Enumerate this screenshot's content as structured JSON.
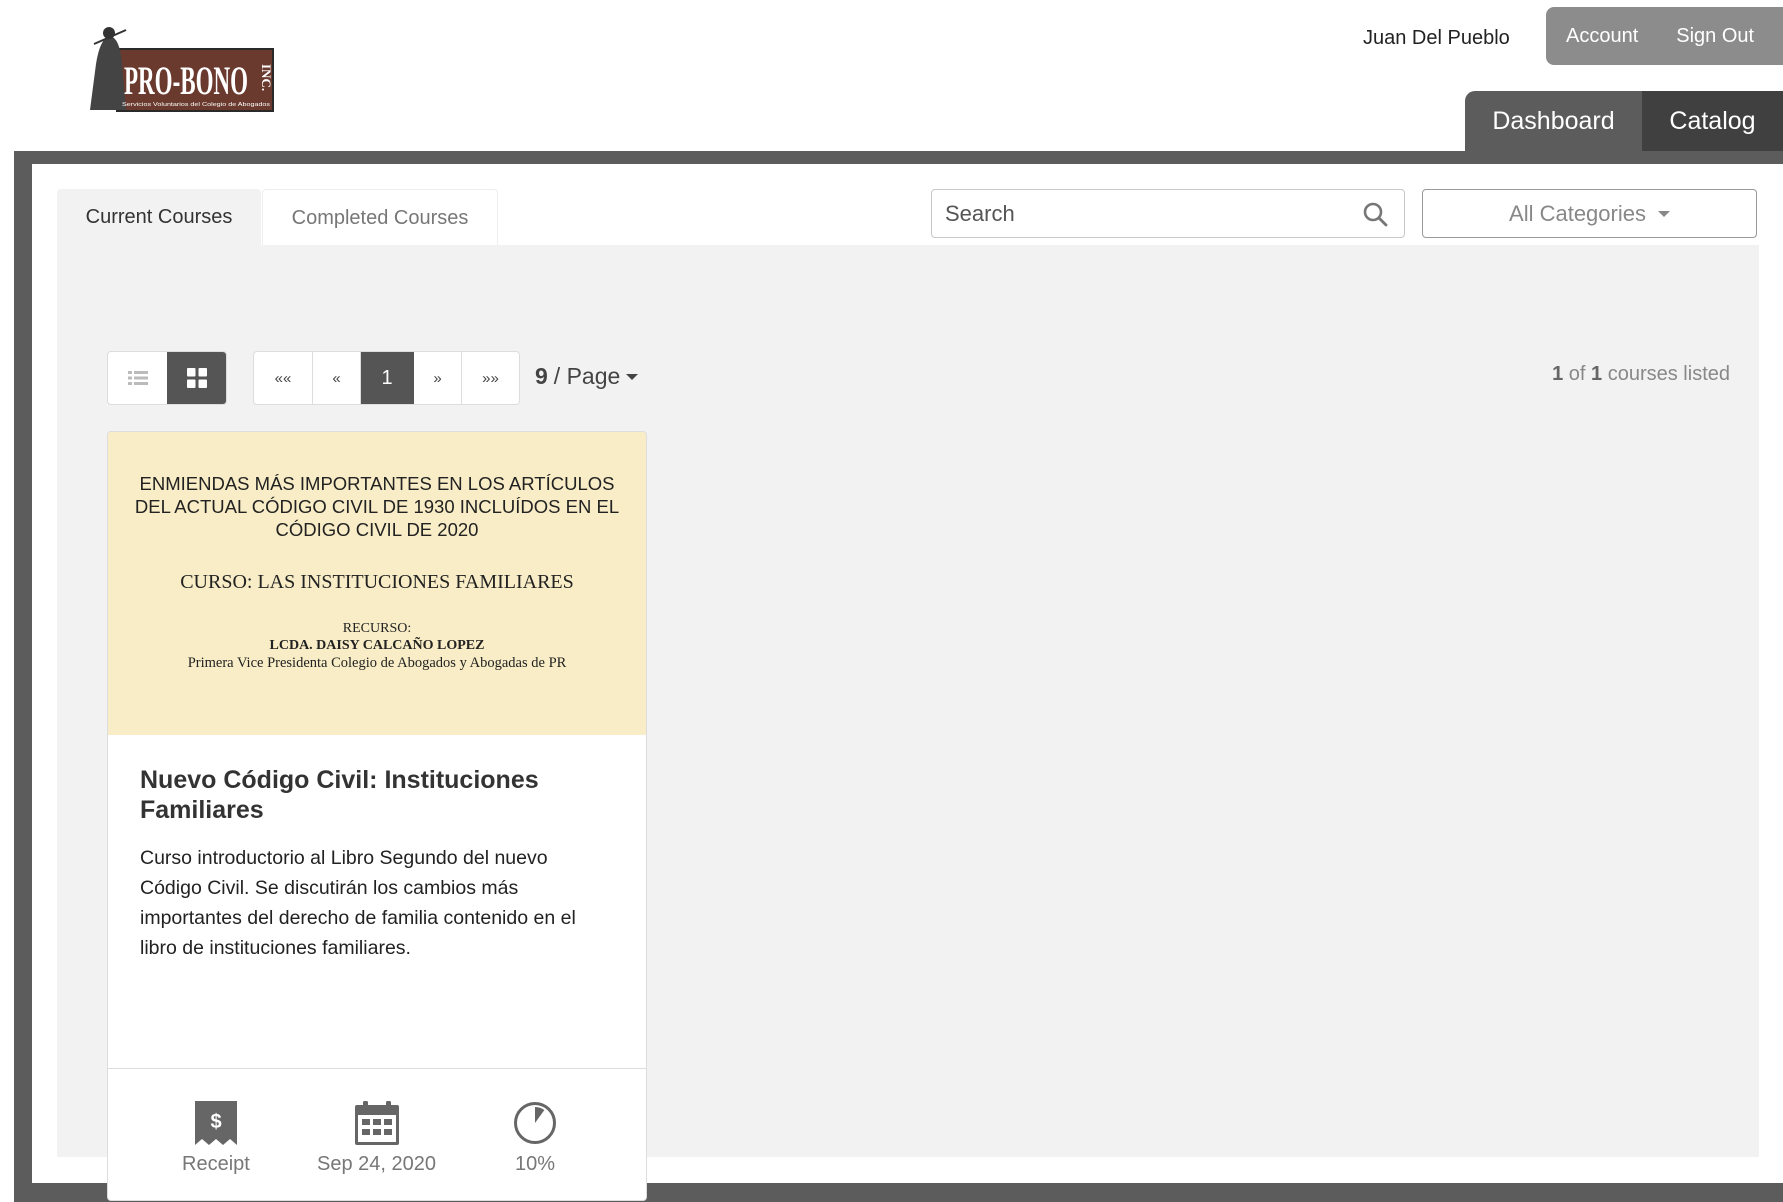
{
  "header": {
    "logo": {
      "wordmark": "PRO-BONO",
      "suffix": "INC.",
      "tagline": "Servicios Voluntarios del Colegio de Abogados"
    },
    "user_name": "Juan Del Pueblo",
    "account_label": "Account",
    "signout_label": "Sign Out",
    "nav": {
      "dashboard": "Dashboard",
      "catalog": "Catalog"
    }
  },
  "tabs": {
    "current": "Current Courses",
    "completed": "Completed Courses"
  },
  "search": {
    "placeholder": "Search",
    "value": ""
  },
  "categories": {
    "selected": "All Categories"
  },
  "pager": {
    "first": "««",
    "prev": "«",
    "current": "1",
    "next": "»",
    "last": "»»"
  },
  "per_page": {
    "value": "9",
    "suffix": "/ Page"
  },
  "count": {
    "shown": "1",
    "of": "of",
    "total": "1",
    "suffix": "courses listed"
  },
  "course": {
    "cover": {
      "line1": "ENMIENDAS MÁS IMPORTANTES EN LOS ARTÍCULOS DEL ACTUAL CÓDIGO CIVIL DE 1930  INCLUÍDOS EN EL CÓDIGO CIVIL DE 2020",
      "line2": "CURSO:   LAS INSTITUCIONES FAMILIARES",
      "line3": "RECURSO:",
      "line4": "LCDA. DAISY CALCAÑO LOPEZ",
      "line5": "Primera Vice Presidenta Colegio de Abogados y Abogadas de PR"
    },
    "title": "Nuevo Código Civil: Instituciones Familiares",
    "description": "Curso introductorio al Libro Segundo del nuevo Código Civil. Se discutirán los cambios más importantes del derecho de familia contenido en el libro de instituciones familiares.",
    "receipt_label": "Receipt",
    "receipt_symbol": "$",
    "date": "Sep 24, 2020",
    "progress_label": "10%",
    "progress_value": 10
  },
  "colors": {
    "frame": "#5c5c5c",
    "nav_active": "#5c5c5c",
    "nav_catalog": "#404040",
    "account_bar": "#8c8c8c",
    "cover_bg": "#f8edc6"
  },
  "icons": [
    "list-view-icon",
    "grid-view-icon",
    "search-icon",
    "receipt-icon",
    "calendar-icon",
    "progress-pie-icon"
  ]
}
